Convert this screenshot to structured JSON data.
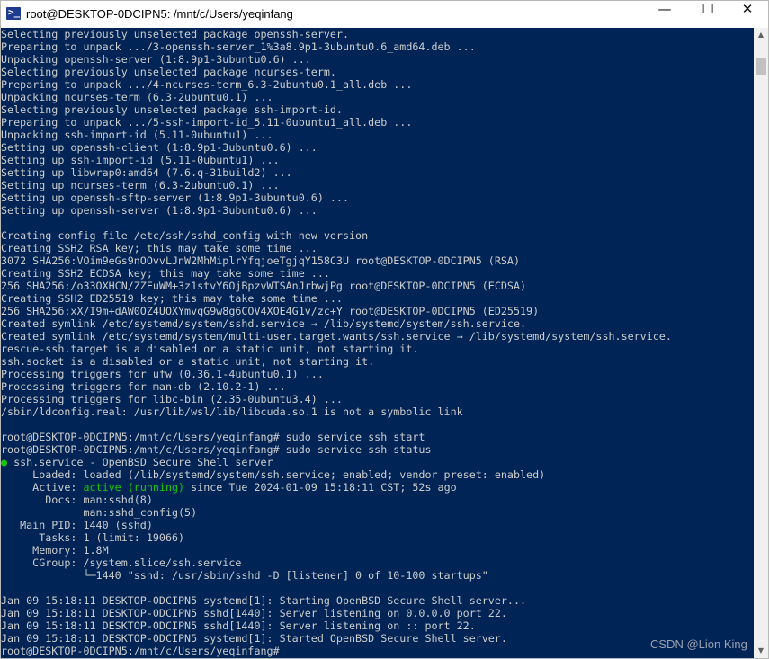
{
  "window": {
    "icon": "terminal-icon",
    "icon_glyph": ">_",
    "title": "root@DESKTOP-0DCIPN5: /mnt/c/Users/yeqinfang",
    "minimize": "—",
    "maximize": "☐",
    "close": "✕"
  },
  "colors": {
    "terminal_bg": "#012456",
    "text": "#cccccc",
    "status_green": "#16c60c"
  },
  "terminal": {
    "lines": [
      "Selecting previously unselected package openssh-server.",
      "Preparing to unpack .../3-openssh-server_1%3a8.9p1-3ubuntu0.6_amd64.deb ...",
      "Unpacking openssh-server (1:8.9p1-3ubuntu0.6) ...",
      "Selecting previously unselected package ncurses-term.",
      "Preparing to unpack .../4-ncurses-term_6.3-2ubuntu0.1_all.deb ...",
      "Unpacking ncurses-term (6.3-2ubuntu0.1) ...",
      "Selecting previously unselected package ssh-import-id.",
      "Preparing to unpack .../5-ssh-import-id_5.11-0ubuntu1_all.deb ...",
      "Unpacking ssh-import-id (5.11-0ubuntu1) ...",
      "Setting up openssh-client (1:8.9p1-3ubuntu0.6) ...",
      "Setting up ssh-import-id (5.11-0ubuntu1) ...",
      "Setting up libwrap0:amd64 (7.6.q-31build2) ...",
      "Setting up ncurses-term (6.3-2ubuntu0.1) ...",
      "Setting up openssh-sftp-server (1:8.9p1-3ubuntu0.6) ...",
      "Setting up openssh-server (1:8.9p1-3ubuntu0.6) ...",
      "",
      "Creating config file /etc/ssh/sshd_config with new version",
      "Creating SSH2 RSA key; this may take some time ...",
      "3072 SHA256:VOim9eGs9nOOvvLJnW2MhMiplrYfqjoeTgjqY158C3U root@DESKTOP-0DCIPN5 (RSA)",
      "Creating SSH2 ECDSA key; this may take some time ...",
      "256 SHA256:/o33OXHCN/ZZEuWM+3z1stvY6OjBpzvWTSAnJrbwjPg root@DESKTOP-0DCIPN5 (ECDSA)",
      "Creating SSH2 ED25519 key; this may take some time ...",
      "256 SHA256:xX/I9m+dAW0OZ4UOXYmvqG9w8g6COV4XOE4G1v/zc+Y root@DESKTOP-0DCIPN5 (ED25519)",
      "Created symlink /etc/systemd/system/sshd.service → /lib/systemd/system/ssh.service.",
      "Created symlink /etc/systemd/system/multi-user.target.wants/ssh.service → /lib/systemd/system/ssh.service.",
      "rescue-ssh.target is a disabled or a static unit, not starting it.",
      "ssh.socket is a disabled or a static unit, not starting it.",
      "Processing triggers for ufw (0.36.1-4ubuntu0.1) ...",
      "Processing triggers for man-db (2.10.2-1) ...",
      "Processing triggers for libc-bin (2.35-0ubuntu3.4) ...",
      "/sbin/ldconfig.real: /usr/lib/wsl/lib/libcuda.so.1 is not a symbolic link",
      "",
      "root@DESKTOP-0DCIPN5:/mnt/c/Users/yeqinfang# sudo service ssh start",
      "root@DESKTOP-0DCIPN5:/mnt/c/Users/yeqinfang# sudo service ssh status"
    ],
    "status": {
      "dot": "●",
      "service_line": " ssh.service - OpenBSD Secure Shell server",
      "loaded": "     Loaded: loaded (/lib/systemd/system/ssh.service; enabled; vendor preset: enabled)",
      "active_label": "     Active: ",
      "active_value": "active (running)",
      "active_rest": " since Tue 2024-01-09 15:18:11 CST; 52s ago",
      "docs1": "       Docs: man:sshd(8)",
      "docs2": "             man:sshd_config(5)",
      "main_pid": "   Main PID: 1440 (sshd)",
      "tasks": "      Tasks: 1 (limit: 19066)",
      "memory": "     Memory: 1.8M",
      "cgroup": "     CGroup: /system.slice/ssh.service",
      "cgroup_child": "             └─1440 \"sshd: /usr/sbin/sshd -D [listener] 0 of 10-100 startups\""
    },
    "journal": [
      "Jan 09 15:18:11 DESKTOP-0DCIPN5 systemd[1]: Starting OpenBSD Secure Shell server...",
      "Jan 09 15:18:11 DESKTOP-0DCIPN5 sshd[1440]: Server listening on 0.0.0.0 port 22.",
      "Jan 09 15:18:11 DESKTOP-0DCIPN5 sshd[1440]: Server listening on :: port 22.",
      "Jan 09 15:18:11 DESKTOP-0DCIPN5 systemd[1]: Started OpenBSD Secure Shell server."
    ],
    "prompt": "root@DESKTOP-0DCIPN5:/mnt/c/Users/yeqinfang#"
  },
  "scrollbar": {
    "up_arrow": "▲",
    "down_arrow": "▼"
  },
  "watermark": "CSDN @Lion King"
}
